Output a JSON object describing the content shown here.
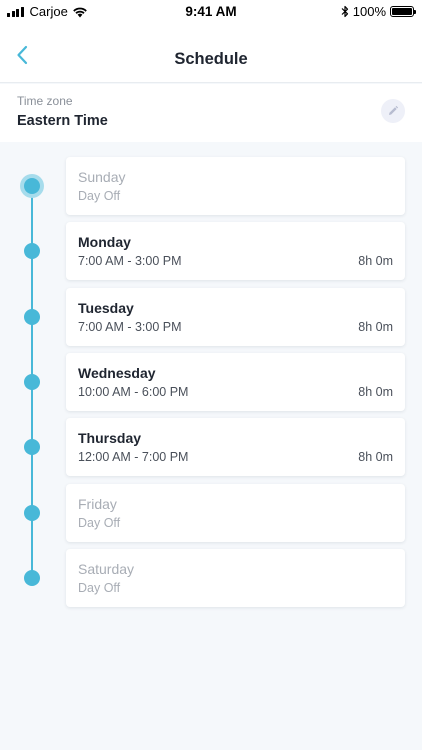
{
  "status_bar": {
    "carrier": "Carjoe",
    "time": "9:41 AM",
    "battery": "100%",
    "battery_level": 1.0
  },
  "nav": {
    "title": "Schedule",
    "back_icon": "chevron-left-icon"
  },
  "timezone": {
    "label": "Time zone",
    "value": "Eastern Time",
    "edit_icon": "pencil-icon"
  },
  "colors": {
    "accent": "#48b8d8",
    "accent_light": "#a6dcec",
    "background": "#f5f8fb"
  },
  "days": [
    {
      "name": "Sunday",
      "hours": "Day Off",
      "duration": "",
      "off": true,
      "active": true
    },
    {
      "name": "Monday",
      "hours": "7:00 AM - 3:00 PM",
      "duration": "8h 0m",
      "off": false,
      "active": false
    },
    {
      "name": "Tuesday",
      "hours": "7:00 AM - 3:00 PM",
      "duration": "8h 0m",
      "off": false,
      "active": false
    },
    {
      "name": "Wednesday",
      "hours": "10:00 AM - 6:00 PM",
      "duration": "8h 0m",
      "off": false,
      "active": false
    },
    {
      "name": "Thursday",
      "hours": "12:00 AM - 7:00 PM",
      "duration": "8h 0m",
      "off": false,
      "active": false
    },
    {
      "name": "Friday",
      "hours": "Day Off",
      "duration": "",
      "off": true,
      "active": false
    },
    {
      "name": "Saturday",
      "hours": "Day Off",
      "duration": "",
      "off": true,
      "active": false
    }
  ]
}
